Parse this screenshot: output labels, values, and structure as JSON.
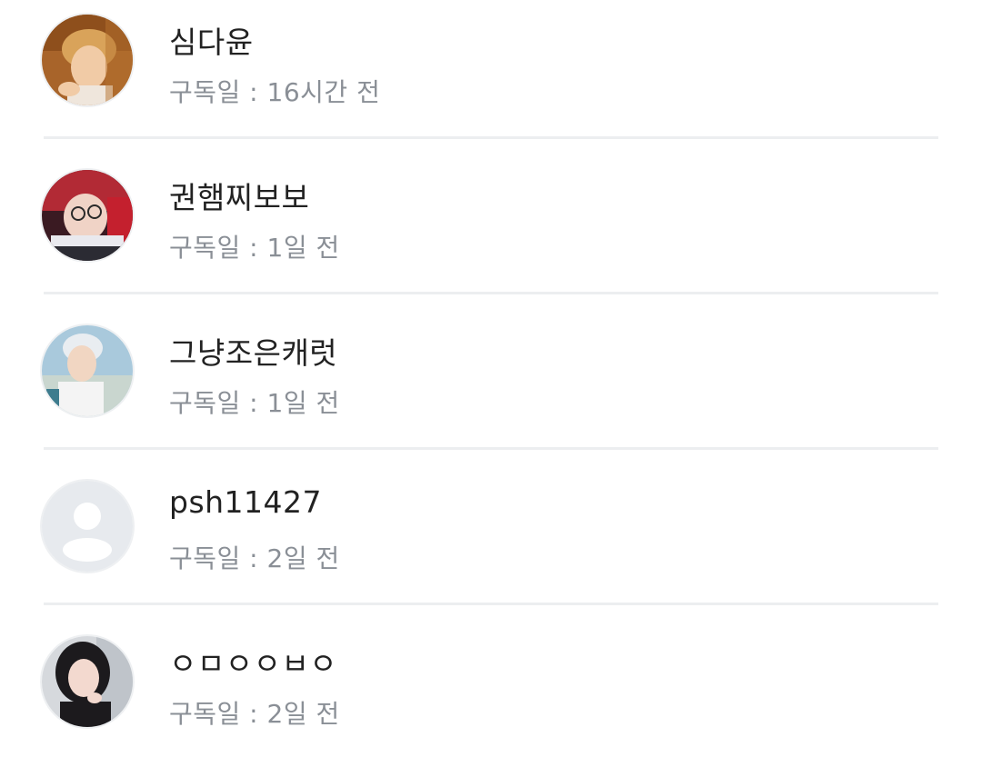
{
  "subscribers": [
    {
      "name": "심다윤",
      "subscribed": "구독일 : 16시간 전",
      "avatar_icon": "user-photo-icon"
    },
    {
      "name": "권햄찌보보",
      "subscribed": "구독일 : 1일 전",
      "avatar_icon": "user-photo-icon"
    },
    {
      "name": "그냥조은캐럿",
      "subscribed": "구독일 : 1일 전",
      "avatar_icon": "user-photo-icon"
    },
    {
      "name": "psh11427",
      "subscribed": "구독일 : 2일 전",
      "avatar_icon": "default-person-icon"
    },
    {
      "name": "ㅇㅁㅇㅇㅂㅇ",
      "subscribed": "구독일 : 2일 전",
      "avatar_icon": "user-photo-icon"
    }
  ]
}
